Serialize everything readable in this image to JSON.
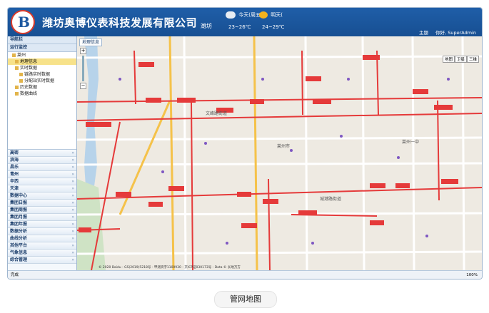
{
  "header": {
    "company": "潍坊奥博仪表科技发展有限公司",
    "city": "潍坊",
    "weather_today_day": "今天(周五)",
    "weather_today_temp": "23~26℃",
    "weather_tomorrow_day": "明天(",
    "weather_tomorrow_temp": "24~29℃",
    "theme_label": "主题",
    "greeting": "你好, SuperAdmin"
  },
  "sidebar": {
    "nav_title": "导航栏",
    "group_title": "运行监控",
    "tree": [
      {
        "label": "莱州",
        "level": 0,
        "selected": false
      },
      {
        "label": "地理信息",
        "level": 1,
        "selected": true
      },
      {
        "label": "实时数据",
        "level": 1,
        "selected": false
      },
      {
        "label": "链路实时数据",
        "level": 2,
        "selected": false
      },
      {
        "label": "分配站实时数据",
        "level": 2,
        "selected": false
      },
      {
        "label": "历史数据",
        "level": 1,
        "selected": false
      },
      {
        "label": "数据曲线",
        "level": 1,
        "selected": false
      }
    ],
    "sections": [
      "高密",
      "滨海",
      "昌乐",
      "青州",
      "辛西",
      "天津",
      "数据中心",
      "集团日报",
      "集团周报",
      "集团月报",
      "集团年报",
      "数据分析",
      "曲线分析",
      "其他平台",
      "气象信息",
      "综合管理"
    ]
  },
  "map": {
    "tab_label": "地理信息",
    "type_map": "地图",
    "type_satellite": "卫星",
    "type_3d": "三维",
    "copyright": "© 2020 Baidu - GS(2019)5218号 - 甲测资字1100930 - 京ICP证030173号 - Data © 长地万方",
    "place_labels": [
      "莱州市",
      "莱州一中",
      "文峰路街道",
      "城港路街道"
    ]
  },
  "statusbar": {
    "left": "完成",
    "right": "100%"
  },
  "caption": "管网地图"
}
